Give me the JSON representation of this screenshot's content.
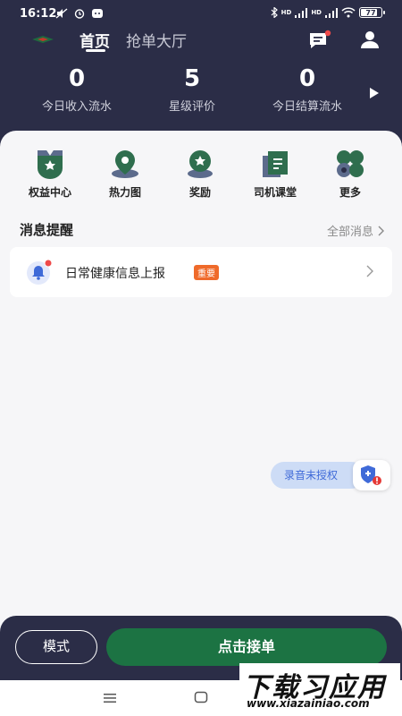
{
  "status_bar": {
    "time": "16:12",
    "signal_labels": [
      "HD",
      "HD"
    ],
    "battery": "77"
  },
  "nav": {
    "tab_home": "首页",
    "tab_hall": "抢单大厅",
    "message_has_badge": true
  },
  "stats": [
    {
      "value": "0",
      "label": "今日收入流水"
    },
    {
      "value": "5",
      "label": "星级评价"
    },
    {
      "value": "0",
      "label": "今日结算流水"
    }
  ],
  "quick_entries": [
    {
      "label": "权益中心",
      "icon": "star-crest-icon"
    },
    {
      "label": "热力图",
      "icon": "map-pin-icon"
    },
    {
      "label": "奖励",
      "icon": "reward-badge-icon"
    },
    {
      "label": "司机课堂",
      "icon": "book-icon"
    },
    {
      "label": "更多",
      "icon": "more-grid-icon"
    }
  ],
  "messages": {
    "heading": "消息提醒",
    "all_label": "全部消息",
    "notice_text": "日常健康信息上报",
    "notice_badge": "重要"
  },
  "record_widget": {
    "label": "录音未授权"
  },
  "bottom_bar": {
    "mode_label": "模式",
    "order_label": "点击接单"
  },
  "watermark": {
    "title": "下载习应用",
    "url": "www.xiazainiao.com"
  },
  "colors": {
    "header_bg": "#2b2d47",
    "accent_green": "#1c7343",
    "icon_green": "#2f6e4e",
    "badge_orange": "#ef6a2a",
    "record_blue": "#3f6ad8"
  }
}
